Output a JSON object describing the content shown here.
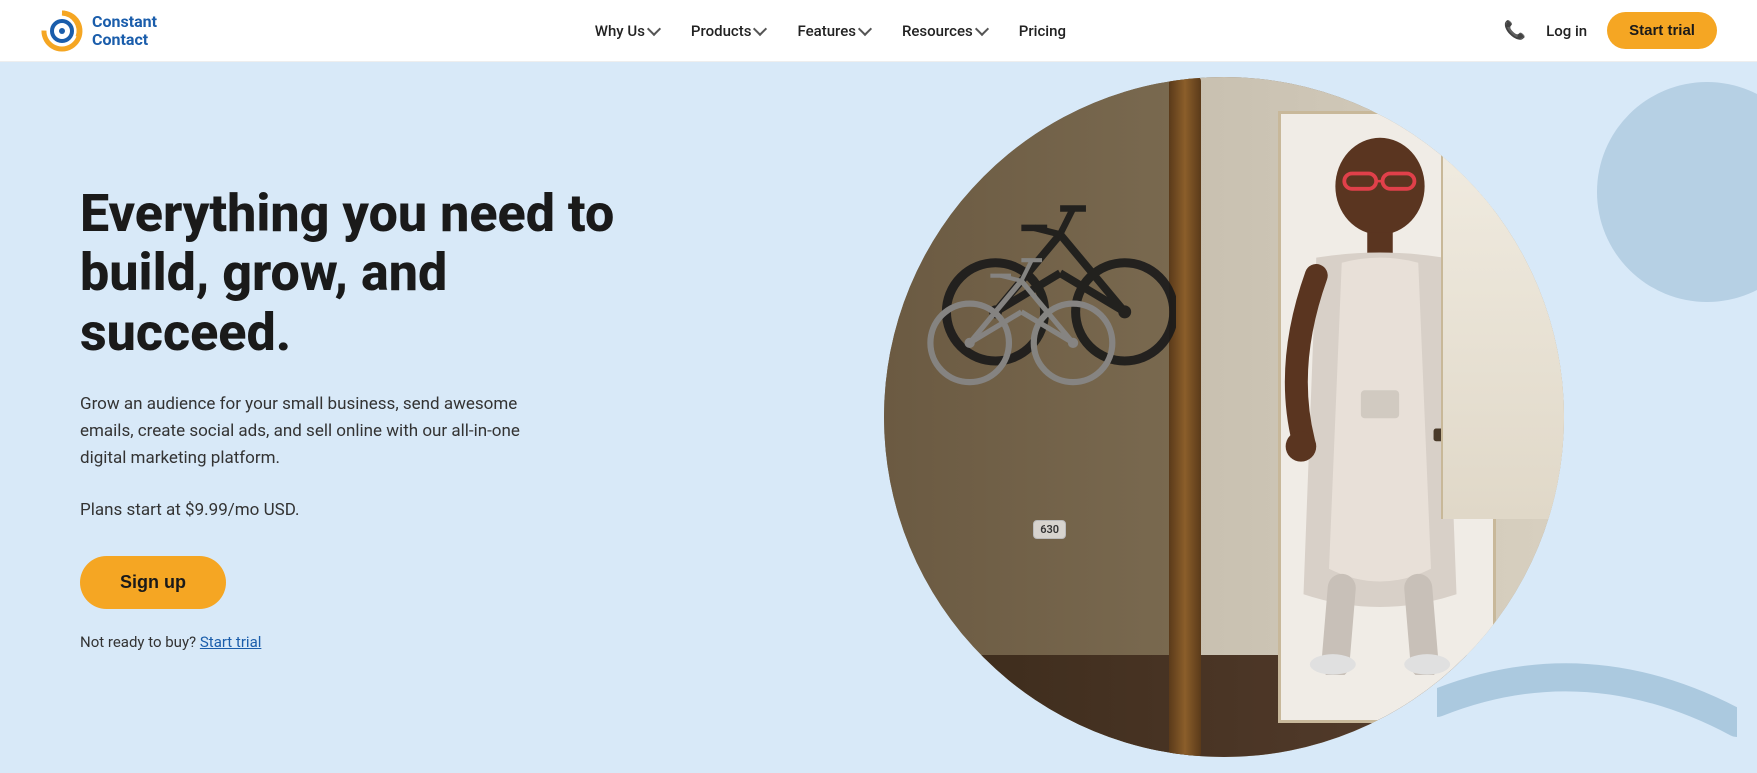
{
  "brand": {
    "name_line1": "Constant",
    "name_line2": "Contact"
  },
  "navbar": {
    "items": [
      {
        "label": "Why Us",
        "has_dropdown": true
      },
      {
        "label": "Products",
        "has_dropdown": true
      },
      {
        "label": "Features",
        "has_dropdown": true
      },
      {
        "label": "Resources",
        "has_dropdown": true
      },
      {
        "label": "Pricing",
        "has_dropdown": false
      }
    ],
    "login_label": "Log in",
    "start_trial_label": "Start trial"
  },
  "hero": {
    "headline": "Everything you need to build, grow, and succeed.",
    "subtext": "Grow an audience for your small business, send awesome emails, create social ads, and sell online with our all-in-one digital marketing platform.",
    "pricing_text": "Plans start at $9.99/mo USD.",
    "signup_label": "Sign up",
    "not_ready_text": "Not ready to buy?",
    "start_trial_link": "Start trial"
  },
  "colors": {
    "hero_bg": "#d8e9f8",
    "accent_orange": "#f5a623",
    "link_blue": "#1a5dab"
  }
}
